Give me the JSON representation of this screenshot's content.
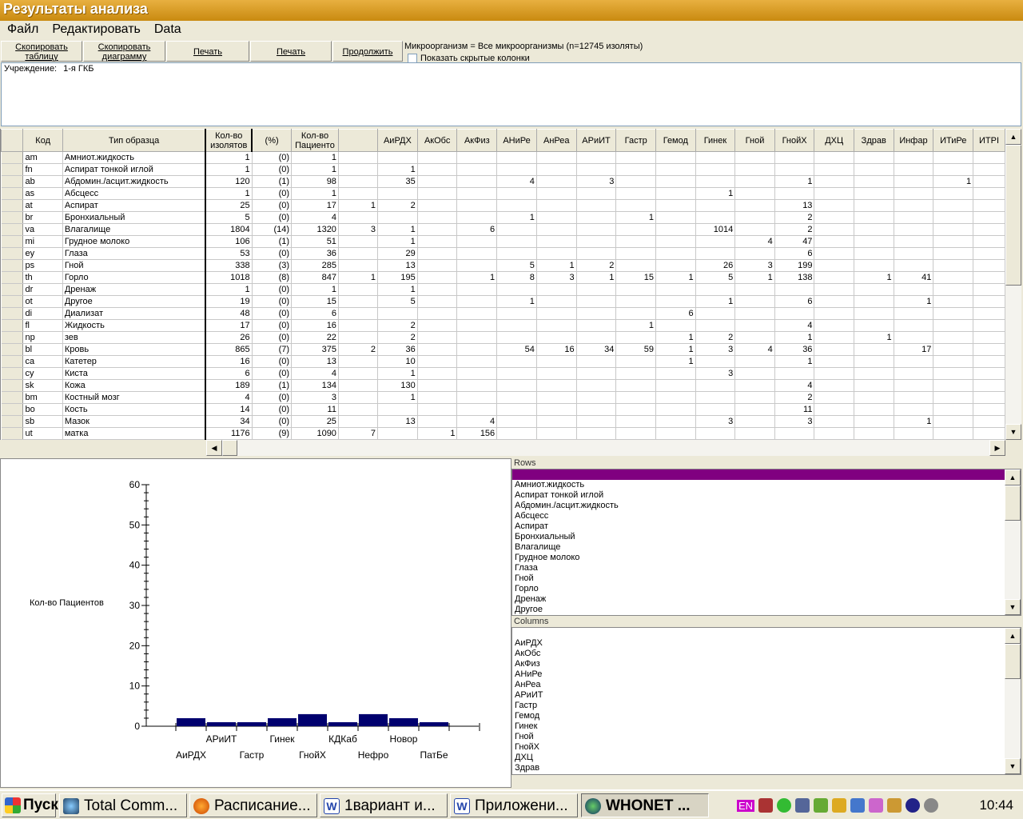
{
  "window": {
    "title": "Результаты анализа"
  },
  "menu": [
    "Файл",
    "Редактировать",
    "Data"
  ],
  "toolbar": {
    "copy_table": [
      "Скопировать",
      "таблицу"
    ],
    "copy_chart": [
      "Скопировать",
      "диаграмму"
    ],
    "print1": "Печать",
    "print2": "Печать",
    "continue": "Продолжить"
  },
  "organism_info": "Микроорганизм = Все микроорганизмы   (n=12745 изоляты)",
  "show_hidden": "Показать скрытые колонки",
  "institution": {
    "label": "Учреждение:",
    "value": "1-я ГКБ"
  },
  "table": {
    "headers": [
      "Код",
      "Тип образца",
      "Кол-во\nизолятов",
      "(%)",
      "Кол-во\nПациенто",
      "",
      "АиРДХ",
      "АкОбс",
      "АкФиз",
      "АНиРе",
      "АнРеа",
      "АРиИТ",
      "Гастр",
      "Гемод",
      "Гинек",
      "Гной",
      "ГнойХ",
      "ДХЦ",
      "Здрав",
      "Инфар",
      "ИТиРе",
      "ИТРI"
    ],
    "rows": [
      [
        "am",
        "Амниот.жидкость",
        "1",
        "(0)",
        "1",
        "",
        "",
        "",
        "",
        "",
        "",
        "",
        "",
        "",
        "",
        "",
        "",
        "",
        "",
        "",
        "",
        ""
      ],
      [
        "fn",
        "Аспират тонкой иглой",
        "1",
        "(0)",
        "1",
        "",
        "1",
        "",
        "",
        "",
        "",
        "",
        "",
        "",
        "",
        "",
        "",
        "",
        "",
        "",
        "",
        ""
      ],
      [
        "ab",
        "Абдомин./асцит.жидкость",
        "120",
        "(1)",
        "98",
        "",
        "35",
        "",
        "",
        "4",
        "",
        "3",
        "",
        "",
        "",
        "",
        "1",
        "",
        "",
        "",
        "1",
        ""
      ],
      [
        "as",
        "Абсцесс",
        "1",
        "(0)",
        "1",
        "",
        "",
        "",
        "",
        "",
        "",
        "",
        "",
        "",
        "1",
        "",
        "",
        "",
        "",
        "",
        "",
        ""
      ],
      [
        "at",
        "Аспират",
        "25",
        "(0)",
        "17",
        "1",
        "2",
        "",
        "",
        "",
        "",
        "",
        "",
        "",
        "",
        "",
        "13",
        "",
        "",
        "",
        "",
        ""
      ],
      [
        "br",
        "Бронхиальный",
        "5",
        "(0)",
        "4",
        "",
        "",
        "",
        "",
        "1",
        "",
        "",
        "1",
        "",
        "",
        "",
        "2",
        "",
        "",
        "",
        "",
        ""
      ],
      [
        "va",
        "Влагалище",
        "1804",
        "(14)",
        "1320",
        "3",
        "1",
        "",
        "6",
        "",
        "",
        "",
        "",
        "",
        "1014",
        "",
        "2",
        "",
        "",
        "",
        "",
        ""
      ],
      [
        "mi",
        "Грудное молоко",
        "106",
        "(1)",
        "51",
        "",
        "1",
        "",
        "",
        "",
        "",
        "",
        "",
        "",
        "",
        "4",
        "47",
        "",
        "",
        "",
        "",
        ""
      ],
      [
        "ey",
        "Глаза",
        "53",
        "(0)",
        "36",
        "",
        "29",
        "",
        "",
        "",
        "",
        "",
        "",
        "",
        "",
        "",
        "6",
        "",
        "",
        "",
        "",
        ""
      ],
      [
        "ps",
        "Гной",
        "338",
        "(3)",
        "285",
        "",
        "13",
        "",
        "",
        "5",
        "1",
        "2",
        "",
        "",
        "26",
        "3",
        "199",
        "",
        "",
        "",
        "",
        ""
      ],
      [
        "th",
        "Горло",
        "1018",
        "(8)",
        "847",
        "1",
        "195",
        "",
        "1",
        "8",
        "3",
        "1",
        "15",
        "1",
        "5",
        "1",
        "138",
        "",
        "1",
        "41",
        "",
        ""
      ],
      [
        "dr",
        "Дренаж",
        "1",
        "(0)",
        "1",
        "",
        "1",
        "",
        "",
        "",
        "",
        "",
        "",
        "",
        "",
        "",
        "",
        "",
        "",
        "",
        "",
        ""
      ],
      [
        "ot",
        "Другое",
        "19",
        "(0)",
        "15",
        "",
        "5",
        "",
        "",
        "1",
        "",
        "",
        "",
        "",
        "1",
        "",
        "6",
        "",
        "",
        "1",
        "",
        ""
      ],
      [
        "di",
        "Диализат",
        "48",
        "(0)",
        "6",
        "",
        "",
        "",
        "",
        "",
        "",
        "",
        "",
        "6",
        "",
        "",
        "",
        "",
        "",
        "",
        "",
        ""
      ],
      [
        "fl",
        "Жидкость",
        "17",
        "(0)",
        "16",
        "",
        "2",
        "",
        "",
        "",
        "",
        "",
        "1",
        "",
        "",
        "",
        "4",
        "",
        "",
        "",
        "",
        ""
      ],
      [
        "np",
        "зев",
        "26",
        "(0)",
        "22",
        "",
        "2",
        "",
        "",
        "",
        "",
        "",
        "",
        "1",
        "2",
        "",
        "1",
        "",
        "1",
        "",
        "",
        ""
      ],
      [
        "bl",
        "Кровь",
        "865",
        "(7)",
        "375",
        "2",
        "36",
        "",
        "",
        "54",
        "16",
        "34",
        "59",
        "1",
        "3",
        "4",
        "36",
        "",
        "",
        "17",
        "",
        ""
      ],
      [
        "ca",
        "Катетер",
        "16",
        "(0)",
        "13",
        "",
        "10",
        "",
        "",
        "",
        "",
        "",
        "",
        "1",
        "",
        "",
        "1",
        "",
        "",
        "",
        "",
        ""
      ],
      [
        "cy",
        "Киста",
        "6",
        "(0)",
        "4",
        "",
        "1",
        "",
        "",
        "",
        "",
        "",
        "",
        "",
        "3",
        "",
        "",
        "",
        "",
        "",
        "",
        ""
      ],
      [
        "sk",
        "Кожа",
        "189",
        "(1)",
        "134",
        "",
        "130",
        "",
        "",
        "",
        "",
        "",
        "",
        "",
        "",
        "",
        "4",
        "",
        "",
        "",
        "",
        ""
      ],
      [
        "bm",
        "Костный мозг",
        "4",
        "(0)",
        "3",
        "",
        "1",
        "",
        "",
        "",
        "",
        "",
        "",
        "",
        "",
        "",
        "2",
        "",
        "",
        "",
        "",
        ""
      ],
      [
        "bo",
        "Кость",
        "14",
        "(0)",
        "11",
        "",
        "",
        "",
        "",
        "",
        "",
        "",
        "",
        "",
        "",
        "",
        "11",
        "",
        "",
        "",
        "",
        ""
      ],
      [
        "sb",
        "Мазок",
        "34",
        "(0)",
        "25",
        "",
        "13",
        "",
        "4",
        "",
        "",
        "",
        "",
        "",
        "3",
        "",
        "3",
        "",
        "",
        "1",
        "",
        ""
      ],
      [
        "ut",
        "матка",
        "1176",
        "(9)",
        "1090",
        "7",
        "",
        "1",
        "156",
        "",
        "",
        "",
        "",
        "",
        "",
        "",
        "",
        "",
        "",
        "",
        "",
        ""
      ]
    ]
  },
  "chart_data": {
    "type": "bar",
    "ylabel": "Кол-во Пациентов",
    "ylim": [
      0,
      60
    ],
    "yticks": [
      "60",
      "50",
      "40",
      "30",
      "20",
      "10",
      "0"
    ],
    "xlabels_top": [
      "АРиИТ",
      "Гинек",
      "КДКаб",
      "Новор"
    ],
    "xlabels_bottom": [
      "АиРДХ",
      "Гастр",
      "ГнойХ",
      "Нефро",
      "ПатБе"
    ],
    "values": [
      2,
      1,
      1,
      2,
      3,
      1,
      3,
      2,
      1
    ],
    "color": "#00006e"
  },
  "rows_panel": {
    "label": "Rows",
    "items": [
      "Амниот.жидкость",
      "Аспират тонкой иглой",
      "Абдомин./асцит.жидкость",
      "Абсцесс",
      "Аспират",
      "Бронхиальный",
      "Влагалище",
      "Грудное молоко",
      "Глаза",
      "Гной",
      "Горло",
      "Дренаж",
      "Другое"
    ]
  },
  "columns_panel": {
    "label": "Columns",
    "items": [
      "АиРДХ",
      "АкОбс",
      "АкФиз",
      "АНиРе",
      "АнРеа",
      "АРиИТ",
      "Гастр",
      "Гемод",
      "Гинек",
      "Гной",
      "ГнойХ",
      "ДХЦ",
      "Здрав"
    ]
  },
  "taskbar": {
    "start": "Пуск",
    "tasks": [
      "Total Comm...",
      "Расписание...",
      "1вариант  и...",
      "Приложени...",
      "WHONET ..."
    ],
    "lang": "EN",
    "clock": "10:44"
  }
}
